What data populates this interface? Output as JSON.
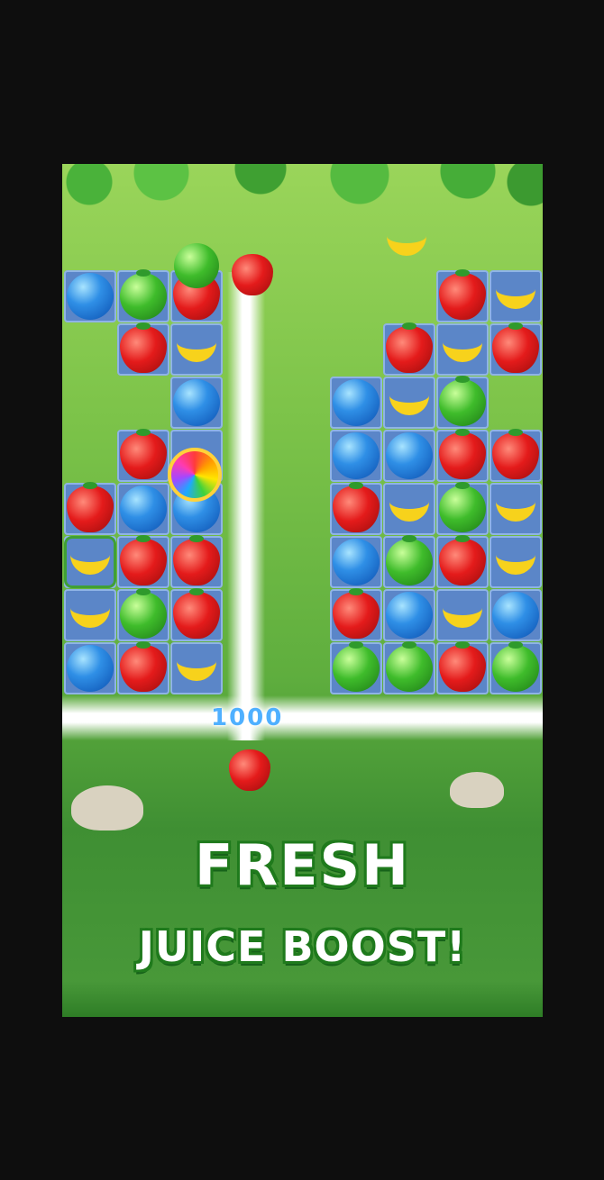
{
  "game": {
    "title_main": "FRESH",
    "title_sub": "JUICE BOOST!",
    "score_popup": "1000"
  },
  "colors": {
    "background": "#0e0e0e",
    "tile": "#5b86c8",
    "headline_text": "#ffffff",
    "headline_outline": "#1f7a1c",
    "score_text": "#4fb0ff"
  },
  "board": {
    "tiles": [
      {
        "fruit": "blueberry"
      },
      {
        "fruit": "apple"
      },
      {
        "fruit": "strawberry"
      },
      {
        "fruit": "empty"
      },
      {
        "fruit": "empty"
      },
      {
        "fruit": "empty"
      },
      {
        "fruit": "strawberry"
      },
      {
        "fruit": "banana"
      },
      {
        "fruit": "empty"
      },
      {
        "fruit": "strawberry"
      },
      {
        "fruit": "banana"
      },
      {
        "fruit": "empty"
      },
      {
        "fruit": "empty"
      },
      {
        "fruit": "strawberry"
      },
      {
        "fruit": "banana"
      },
      {
        "fruit": "strawberry"
      },
      {
        "fruit": "empty"
      },
      {
        "fruit": "empty"
      },
      {
        "fruit": "blueberry"
      },
      {
        "fruit": "empty"
      },
      {
        "fruit": "blueberry"
      },
      {
        "fruit": "banana"
      },
      {
        "fruit": "apple"
      },
      {
        "fruit": "empty"
      },
      {
        "fruit": "empty"
      },
      {
        "fruit": "strawberry"
      },
      {
        "fruit": "rainbow"
      },
      {
        "fruit": "empty"
      },
      {
        "fruit": "blueberry"
      },
      {
        "fruit": "blueberry"
      },
      {
        "fruit": "strawberry"
      },
      {
        "fruit": "strawberry"
      },
      {
        "fruit": "strawberry"
      },
      {
        "fruit": "blueberry"
      },
      {
        "fruit": "blueberry"
      },
      {
        "fruit": "empty"
      },
      {
        "fruit": "strawberry"
      },
      {
        "fruit": "banana"
      },
      {
        "fruit": "apple"
      },
      {
        "fruit": "banana"
      },
      {
        "fruit": "caged_banana"
      },
      {
        "fruit": "strawberry"
      },
      {
        "fruit": "strawberry"
      },
      {
        "fruit": "empty"
      },
      {
        "fruit": "blueberry"
      },
      {
        "fruit": "apple"
      },
      {
        "fruit": "strawberry"
      },
      {
        "fruit": "banana"
      },
      {
        "fruit": "banana"
      },
      {
        "fruit": "apple"
      },
      {
        "fruit": "strawberry"
      },
      {
        "fruit": "empty"
      },
      {
        "fruit": "strawberry"
      },
      {
        "fruit": "blueberry"
      },
      {
        "fruit": "banana"
      },
      {
        "fruit": "blueberry"
      },
      {
        "fruit": "blueberry"
      },
      {
        "fruit": "strawberry"
      },
      {
        "fruit": "banana"
      },
      {
        "fruit": "empty"
      },
      {
        "fruit": "apple"
      },
      {
        "fruit": "apple"
      },
      {
        "fruit": "strawberry"
      },
      {
        "fruit": "apple"
      }
    ]
  }
}
